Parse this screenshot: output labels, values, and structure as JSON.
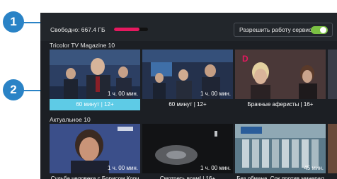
{
  "topbar": {
    "free_space": "Свободно: 667.4 ГБ",
    "storage_fill": 0.75,
    "allow_service": "Разрешить работу сервиса"
  },
  "callouts": [
    "1",
    "2"
  ],
  "sections": [
    {
      "title": "Tricolor TV Magazine  10",
      "cards": [
        {
          "duration": "1 ч. 00 мин.",
          "caption": "60 минут | 12+",
          "selected": true
        },
        {
          "duration": "1 ч. 00 мин.",
          "caption": "60 минут | 12+",
          "selected": false
        },
        {
          "duration": "",
          "caption": "Брачные аферисты | 16+",
          "selected": false
        }
      ]
    },
    {
      "title": "Актуальное  10",
      "cards": [
        {
          "duration": "1 ч. 00 мин.",
          "caption": "Судьба человека с Борисом Корч",
          "selected": false
        },
        {
          "duration": "1 ч. 00 мин.",
          "caption": "Смотреть всем! | 16+",
          "selected": false
        },
        {
          "duration": "45 мин.",
          "caption": "Без обмана. Сок против минерал",
          "selected": false
        }
      ]
    }
  ],
  "colors": {
    "accent": "#e5195f",
    "toggle_on": "#7bc043",
    "selection": "#5ecbe6",
    "callout": "#2a83c6"
  }
}
